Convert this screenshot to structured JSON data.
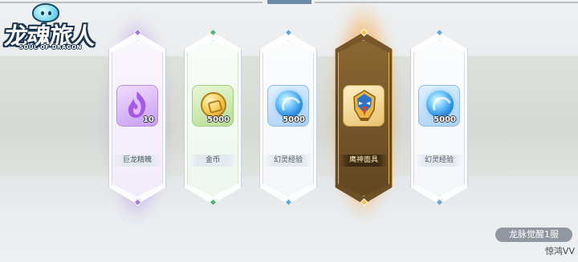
{
  "logo": {
    "title": "龙魂旅人",
    "subtitle": "SOUL OF DRAGON"
  },
  "rewards": [
    {
      "name": "巨龙精魄",
      "quantity": "10",
      "icon": "purple-flame-icon",
      "rarity_color": "#b98ce6"
    },
    {
      "name": "金币",
      "quantity": "5000",
      "icon": "gold-coin-icon",
      "rarity_color": "#9fcf79"
    },
    {
      "name": "幻灵经验",
      "quantity": "5000",
      "icon": "blue-orb-icon",
      "rarity_color": "#8dbde9"
    },
    {
      "name": "鹰神面具",
      "quantity": "",
      "icon": "eagle-mask-icon",
      "rarity_color": "#e3b865"
    },
    {
      "name": "幻灵经验",
      "quantity": "5000",
      "icon": "blue-orb-icon",
      "rarity_color": "#8dbde9"
    }
  ],
  "server": "龙脉觉醒1服",
  "player": "惊鸿VV",
  "colors": {
    "gold_glow": "#ffaa28",
    "purple_glow": "#b982f5",
    "background": "#eef0f2"
  }
}
